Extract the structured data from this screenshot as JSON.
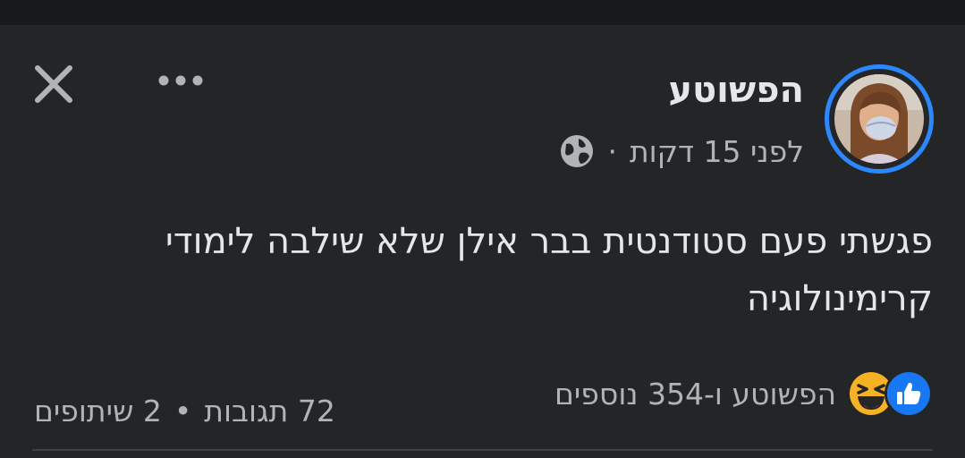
{
  "post": {
    "page_name": "הפשוטע",
    "timestamp": "לפני 15 דקות",
    "separator": "·",
    "privacy_icon": "globe-icon",
    "text": "פגשתי פעם סטודנטית בבר אילן שלא שילבה לימודי קרימינולוגיה",
    "reactions": {
      "icons": [
        "like-icon",
        "haha-icon"
      ],
      "summary": "הפשוטע ו-354 נוספים"
    },
    "comments": "72 תגובות",
    "dot": "•",
    "shares": "2 שיתופים"
  },
  "header": {
    "close_icon": "close-icon",
    "more_icon": "more-options-icon"
  },
  "colors": {
    "background": "#242526",
    "text_primary": "#e4e6eb",
    "text_secondary": "#b0b3b8",
    "accent": "#2d88ff",
    "like_blue": "#1877f2",
    "haha_yellow": "#f7b125"
  }
}
